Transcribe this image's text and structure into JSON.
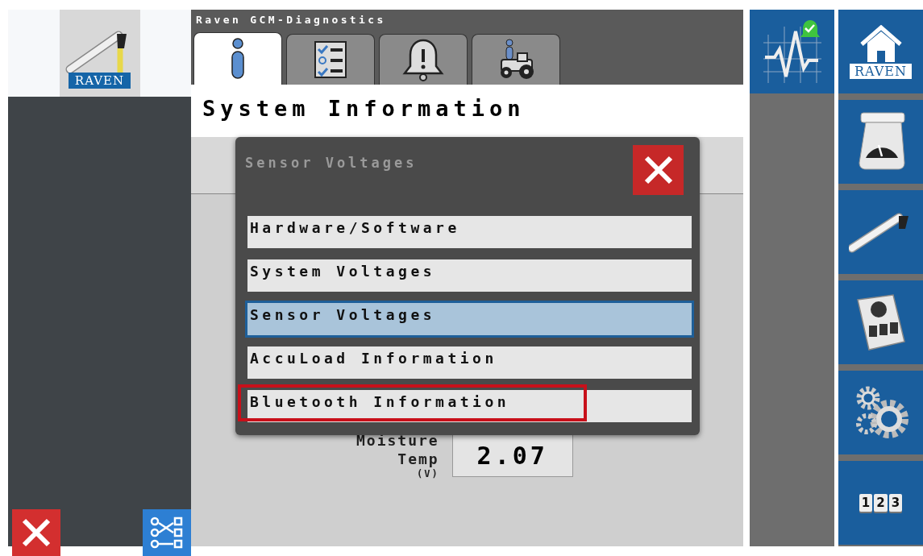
{
  "logo": {
    "text": "RAVEN"
  },
  "window": {
    "title": "Raven GCM-Diagnostics"
  },
  "tabs": [
    {
      "kind": "info",
      "selected": true
    },
    {
      "kind": "checklist",
      "selected": false
    },
    {
      "kind": "alarm",
      "selected": false
    },
    {
      "kind": "tractor",
      "selected": false
    }
  ],
  "header": {
    "title": "System Information"
  },
  "background_reading": {
    "label_lines": [
      "Moisture",
      "Temp"
    ],
    "unit": "(V)",
    "value": "2.07"
  },
  "dialog": {
    "title": "Sensor Voltages",
    "items": [
      {
        "label": "Hardware/Software",
        "selected": false,
        "highlighted": false
      },
      {
        "label": "System Voltages",
        "selected": false,
        "highlighted": false
      },
      {
        "label": "Sensor Voltages",
        "selected": true,
        "highlighted": false
      },
      {
        "label": "AccuLoad Information",
        "selected": false,
        "highlighted": false
      },
      {
        "label": "Bluetooth Information",
        "selected": false,
        "highlighted": true
      }
    ]
  },
  "side_buttons": [
    {
      "kind": "home",
      "text": "RAVEN"
    },
    {
      "kind": "scale"
    },
    {
      "kind": "boom"
    },
    {
      "kind": "console"
    },
    {
      "kind": "gears"
    },
    {
      "kind": "numbers",
      "keys": [
        "1",
        "2",
        "3"
      ]
    }
  ]
}
